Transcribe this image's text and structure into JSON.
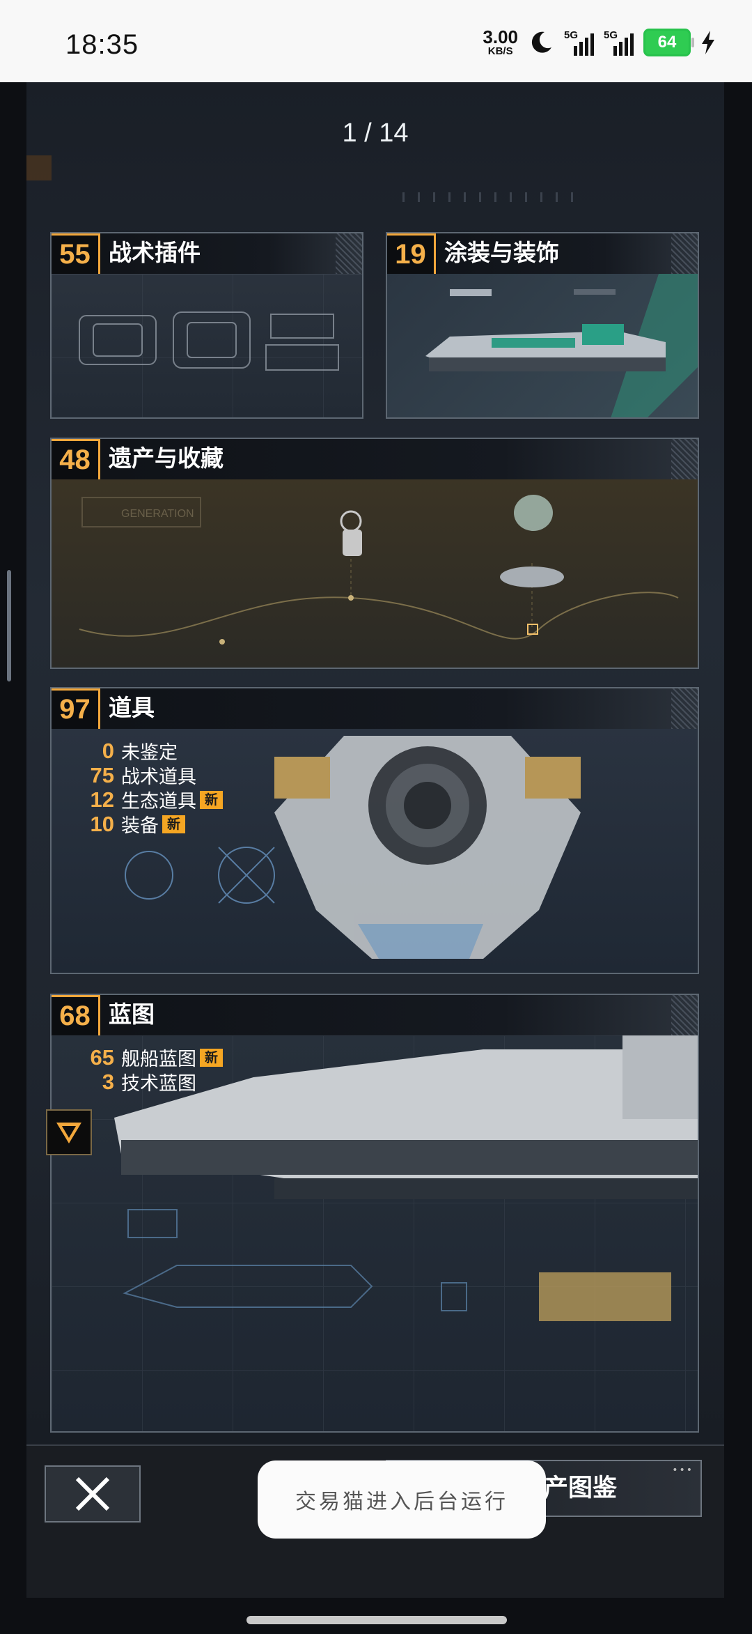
{
  "status_bar": {
    "time": "18:35",
    "net_speed_value": "3.00",
    "net_speed_unit": "KB/S",
    "signal1_label": "5G",
    "signal2_label": "5G",
    "battery": "64"
  },
  "viewer": {
    "page_indicator": "1 / 14"
  },
  "cards": {
    "tactical_plugins": {
      "count": "55",
      "title": "战术插件"
    },
    "paint_decor": {
      "count": "19",
      "title": "涂装与装饰"
    },
    "legacy": {
      "count": "48",
      "title": "遗产与收藏",
      "watermark": "GENERATION"
    },
    "items": {
      "count": "97",
      "title": "道具",
      "stats": [
        {
          "num": "0",
          "label": "未鉴定"
        },
        {
          "num": "75",
          "label": "战术道具"
        },
        {
          "num": "12",
          "label": "生态道具",
          "badge": "新"
        },
        {
          "num": "10",
          "label": "装备",
          "badge": "新"
        }
      ]
    },
    "blueprints": {
      "count": "68",
      "title": "蓝图",
      "stats": [
        {
          "num": "65",
          "label": "舰船蓝图",
          "badge": "新"
        },
        {
          "num": "3",
          "label": "技术蓝图"
        }
      ]
    }
  },
  "bottom_bar": {
    "codex_label": "资产图鉴"
  },
  "toast": {
    "text": "交易猫进入后台运行"
  },
  "colors": {
    "accent": "#f5b04a",
    "badge": "#f5a623",
    "battery": "#2fcc52"
  }
}
